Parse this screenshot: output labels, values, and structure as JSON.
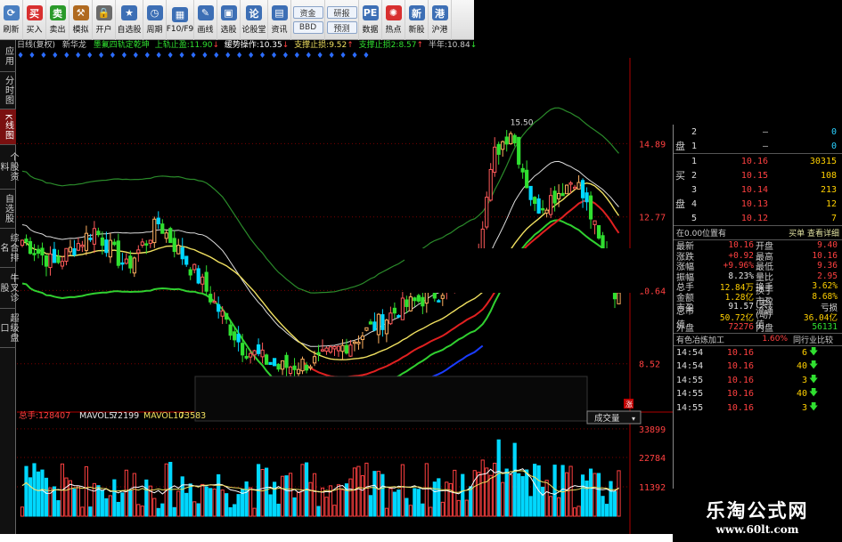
{
  "toolbar": {
    "buttons": [
      {
        "label": "刷新",
        "icon": "refresh-icon",
        "glyph": "⟳",
        "color": "#4a7fc1"
      },
      {
        "label": "买入",
        "icon": "buy-icon",
        "glyph": "买",
        "color": "#d83030"
      },
      {
        "label": "卖出",
        "icon": "sell-icon",
        "glyph": "卖",
        "color": "#2a9a2a"
      },
      {
        "label": "模拟",
        "icon": "hammer-icon",
        "glyph": "⚒",
        "color": "#b06a20"
      },
      {
        "label": "开户",
        "icon": "lock-icon",
        "glyph": "🔒",
        "color": "#6b6b6b"
      },
      {
        "label": "自选股",
        "icon": "star-list-icon",
        "glyph": "★",
        "color": "#3d6fb5"
      },
      {
        "label": "周期",
        "icon": "clock-icon",
        "glyph": "◷",
        "color": "#3d6fb5"
      },
      {
        "label": "F10/F9",
        "icon": "f10-icon",
        "glyph": "▦",
        "color": "#3d6fb5"
      },
      {
        "label": "画线",
        "icon": "pencil-icon",
        "glyph": "✎",
        "color": "#3d6fb5"
      },
      {
        "label": "选股",
        "icon": "filter-icon",
        "glyph": "▣",
        "color": "#3d6fb5"
      },
      {
        "label": "论股堂",
        "icon": "forum-icon",
        "glyph": "论",
        "color": "#3d6fb5"
      },
      {
        "label": "资讯",
        "icon": "news-icon",
        "glyph": "▤",
        "color": "#3d6fb5"
      }
    ],
    "pairs": [
      {
        "top": "资金",
        "bottom": "BBD"
      },
      {
        "top": "研报",
        "bottom": "预测"
      }
    ],
    "tail": [
      {
        "label": "数据",
        "icon": "pe-data-icon",
        "glyph": "PE",
        "color": "#3d6fb5"
      },
      {
        "label": "热点",
        "icon": "hotspot-icon",
        "glyph": "✺",
        "color": "#d83030"
      },
      {
        "label": "新股",
        "icon": "new-stock-icon",
        "glyph": "新",
        "color": "#3d6fb5"
      },
      {
        "label": "沪港",
        "icon": "hk-connect-icon",
        "glyph": "港",
        "color": "#3d6fb5"
      }
    ]
  },
  "left_tabs": [
    {
      "label": "应用",
      "active": false
    },
    {
      "label": "分时图",
      "active": false
    },
    {
      "label": "K线图",
      "active": true
    },
    {
      "label": "个股资料",
      "active": false
    },
    {
      "label": "自选股",
      "active": false
    },
    {
      "label": "综合排名",
      "active": false
    },
    {
      "label": "牛叉诊股",
      "active": false
    },
    {
      "label": "超级盘口",
      "active": false
    }
  ],
  "chart_header": {
    "period": "日线(复权)",
    "stock": "新华龙",
    "indicator": "墨氟四轨定乾坤",
    "upper_stop_label": "上轨止盈:",
    "upper_stop": "11.90",
    "trend_label": "缓势操作:",
    "trend": "10.35",
    "support1_label": "支撑止损:",
    "support1": "9.52",
    "support2_label": "支撑止损2:",
    "support2": "8.57",
    "half_year_label": "半年:",
    "half_year": "10.84",
    "markers": "♦ ♦ ♦ ♦ ♦ ♦ ♦ ♦ ♦ ♦ ♦ ♦ ♦ ♦ ♦ ♦ ♦ ♦ ♦ ♦ ♦ ♦ ♦ ♦ ♦ ♦ ♦ ♦ ♦ ♦ ♦"
  },
  "price_axis": [
    "14.89",
    "12.77",
    "10.64",
    "8.52"
  ],
  "peak_label": "15.50",
  "volume_header": {
    "label": "总手:",
    "value": "128407",
    "ma5_label": "MAVOL5:",
    "ma5": "72199",
    "ma10_label": "MAVOL10:",
    "ma10": "73583"
  },
  "volume_axis": [
    "33899",
    "22784",
    "11392"
  ],
  "volume_selector": "成交量",
  "chart_data": {
    "type": "candlestick",
    "price_range": [
      7.2,
      16.6
    ],
    "price_ticks": [
      14.89,
      12.77,
      10.64,
      8.52
    ],
    "peak": 15.5,
    "volume_range": [
      0,
      38000
    ],
    "volume_ticks": [
      33899,
      22784,
      11392
    ]
  },
  "order_book": {
    "sell": [
      {
        "side": "",
        "level": "2",
        "price": "–",
        "vol": "0"
      },
      {
        "side": "盘",
        "level": "1",
        "price": "–",
        "vol": "0"
      }
    ],
    "buy": [
      {
        "side": "",
        "level": "1",
        "price": "10.16",
        "vol": "30315"
      },
      {
        "side": "买",
        "level": "2",
        "price": "10.15",
        "vol": "108"
      },
      {
        "side": "",
        "level": "3",
        "price": "10.14",
        "vol": "213"
      },
      {
        "side": "盘",
        "level": "4",
        "price": "10.13",
        "vol": "12"
      },
      {
        "side": "",
        "level": "5",
        "price": "10.12",
        "vol": "7"
      }
    ],
    "sell_side_label": "盘"
  },
  "info_head": {
    "left": "在0.00位置有",
    "right": "买单 查看详细"
  },
  "info_rows": [
    {
      "k": "最新",
      "v": "10.16",
      "vc": "red",
      "k2": "开盘",
      "v2": "9.40",
      "v2c": "red"
    },
    {
      "k": "涨跌",
      "v": "+0.92",
      "vc": "red",
      "k2": "最高",
      "v2": "10.16",
      "v2c": "red"
    },
    {
      "k": "涨幅",
      "v": "+9.96%",
      "vc": "red",
      "k2": "最低",
      "v2": "9.36",
      "v2c": "red"
    },
    {
      "k": "振幅",
      "v": "8.23%",
      "vc": "wht",
      "k2": "量比",
      "v2": "2.95",
      "v2c": "red"
    },
    {
      "k": "总手",
      "v": "12.84万",
      "vc": "yel",
      "k2": "换手",
      "v2": "3.62%",
      "v2c": "yel"
    },
    {
      "k": "金额",
      "v": "1.28亿",
      "vc": "yel",
      "k2": "换手(实)",
      "v2": "8.68%",
      "v2c": "yel"
    },
    {
      "k": "市盈",
      "v": "91.57",
      "vc": "wht",
      "k2": "市盈(动)",
      "v2": "亏损",
      "v2c": "wht"
    },
    {
      "k": "总市值",
      "v": "50.72亿",
      "vc": "yel",
      "k2": "流通值",
      "v2": "36.04亿",
      "v2c": "yel"
    },
    {
      "k": "外盘",
      "v": "72276",
      "vc": "red",
      "k2": "内盘",
      "v2": "56131",
      "v2c": "grn"
    }
  ],
  "sector": {
    "name": "有色冶炼加工",
    "change": "1.60%",
    "compare": "同行业比较"
  },
  "ticks": [
    {
      "time": "14:54",
      "price": "10.16",
      "qty": "6"
    },
    {
      "time": "14:54",
      "price": "10.16",
      "qty": "40"
    },
    {
      "time": "14:55",
      "price": "10.16",
      "qty": "3"
    },
    {
      "time": "14:55",
      "price": "10.16",
      "qty": "40"
    },
    {
      "time": "14:55",
      "price": "10.16",
      "qty": "3"
    }
  ],
  "watermark": {
    "name": "乐淘公式网",
    "url": "www.60lt.com"
  },
  "colors": {
    "up": "#ff4040",
    "down": "#00e0e0",
    "bear_candle": "#30e030",
    "upper_band": "#2a8a2a",
    "mid_line": "#dddddd",
    "yellow_line": "#f0e060",
    "red_line": "#e02020",
    "blue_line": "#1a3cff"
  }
}
